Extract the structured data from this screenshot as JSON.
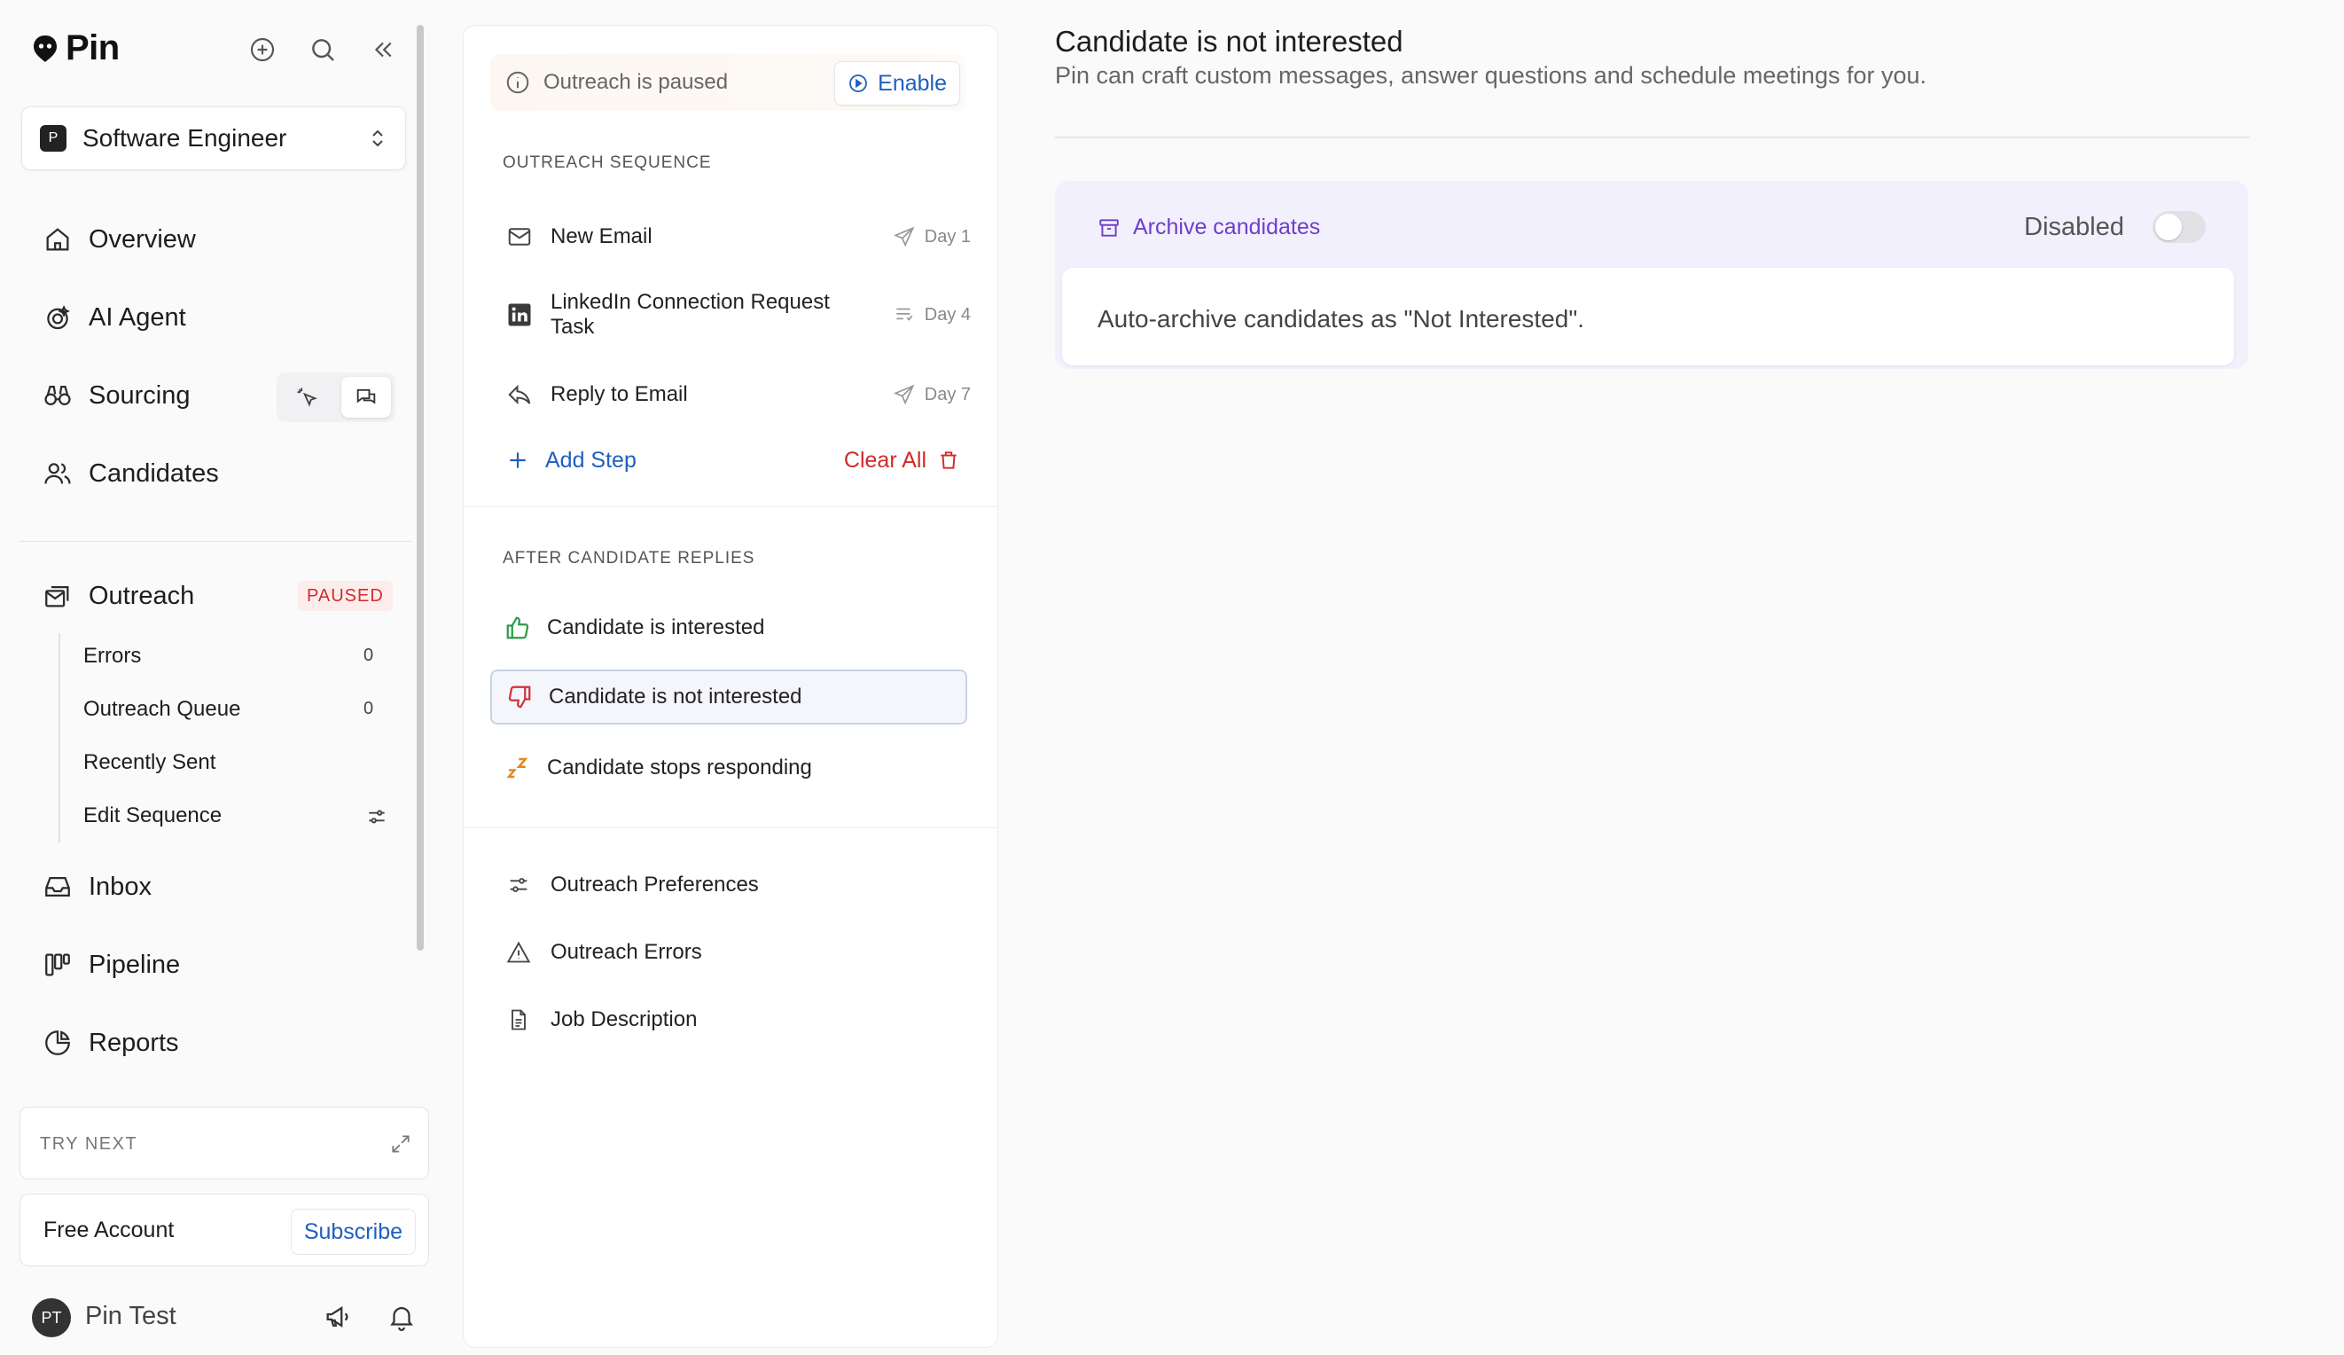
{
  "app": {
    "name": "Pin"
  },
  "sidebar": {
    "job": {
      "badge": "P",
      "name": "Software Engineer"
    },
    "nav": [
      {
        "label": "Overview",
        "icon": "home-icon"
      },
      {
        "label": "AI Agent",
        "icon": "ai-agent-icon"
      },
      {
        "label": "Sourcing",
        "icon": "binoculars-icon"
      },
      {
        "label": "Candidates",
        "icon": "users-icon"
      },
      {
        "label": "Outreach",
        "icon": "outreach-icon"
      },
      {
        "label": "Inbox",
        "icon": "inbox-icon"
      },
      {
        "label": "Pipeline",
        "icon": "pipeline-icon"
      },
      {
        "label": "Reports",
        "icon": "pie-chart-icon"
      }
    ],
    "outreach_badge": "PAUSED",
    "outreach_sub": [
      {
        "label": "Errors",
        "count": "0"
      },
      {
        "label": "Outreach Queue",
        "count": "0"
      },
      {
        "label": "Recently Sent"
      },
      {
        "label": "Edit Sequence"
      }
    ],
    "try_next": "TRY NEXT",
    "account": {
      "label": "Free Account",
      "subscribe": "Subscribe"
    },
    "user": {
      "initials": "PT",
      "name": "Pin Test"
    }
  },
  "sequence": {
    "paused_text": "Outreach is paused",
    "enable_label": "Enable",
    "section_title": "OUTREACH SEQUENCE",
    "steps": [
      {
        "label": "New Email",
        "day": "Day 1"
      },
      {
        "label": "LinkedIn Connection Request Task",
        "day": "Day 4"
      },
      {
        "label": "Reply to Email",
        "day": "Day 7"
      }
    ],
    "add_step": "Add Step",
    "clear_all": "Clear All",
    "replies_title": "AFTER CANDIDATE REPLIES",
    "replies": [
      {
        "label": "Candidate is interested"
      },
      {
        "label": "Candidate is not interested"
      },
      {
        "label": "Candidate stops responding"
      }
    ],
    "utilities": [
      {
        "label": "Outreach Preferences"
      },
      {
        "label": "Outreach Errors"
      },
      {
        "label": "Job Description"
      }
    ]
  },
  "detail": {
    "title": "Candidate is not interested",
    "subtitle": "Pin can craft custom messages, answer questions and schedule meetings for you.",
    "archive": {
      "title": "Archive candidates",
      "status": "Disabled",
      "enabled": false,
      "description": "Auto-archive candidates as \"Not Interested\"."
    }
  },
  "colors": {
    "accent_blue": "#1f5fbf",
    "paused_red": "#d12b2b",
    "archive_purple": "#6f3ec9",
    "interested_green": "#2e9a4a",
    "not_interested_red": "#d0333a",
    "zzz_orange": "#e08a1e"
  }
}
